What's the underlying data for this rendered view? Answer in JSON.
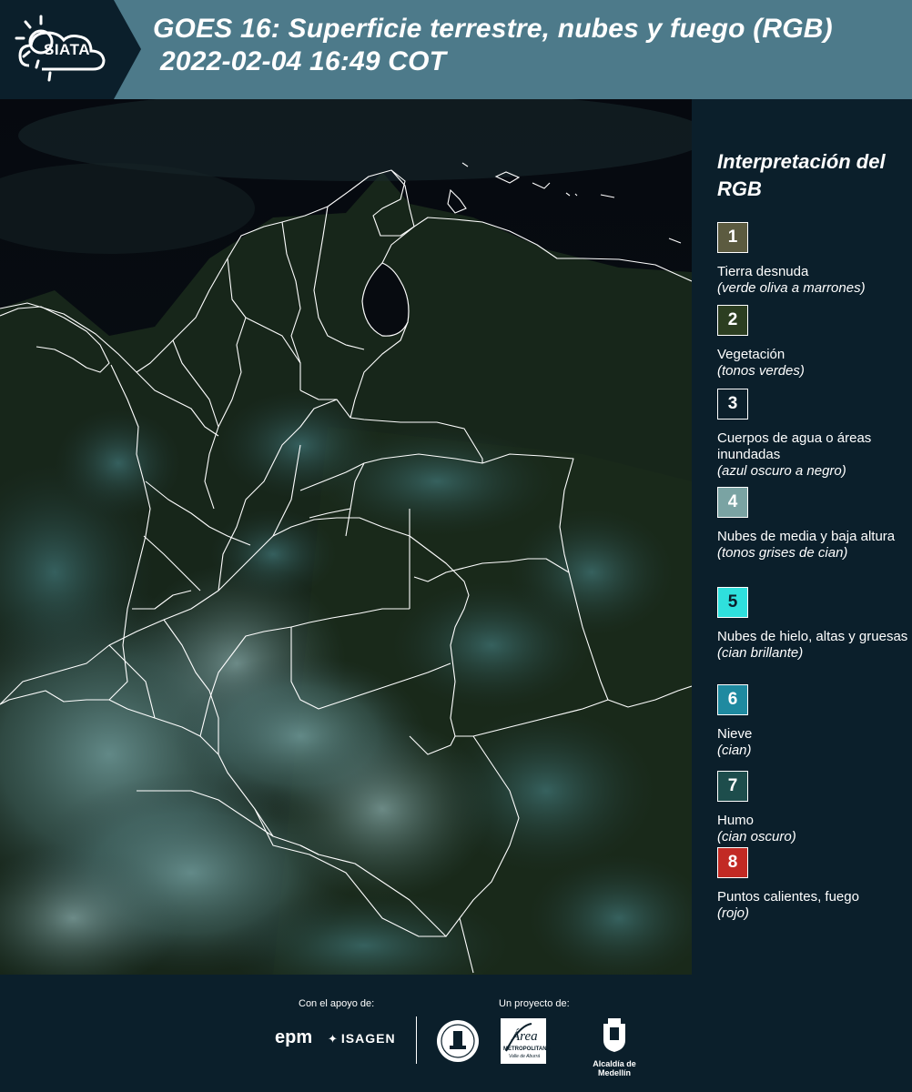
{
  "header": {
    "logo_text": "SIATA",
    "title_line1": "GOES 16: Superficie terrestre, nubes y fuego (RGB)",
    "title_line2": "2022-02-04 16:49 COT"
  },
  "legend": {
    "title": "Interpretación del RGB",
    "items": [
      {
        "number": "1",
        "label": "Tierra desnuda",
        "description": "(verde oliva a marrones)",
        "color": "#5c5b40",
        "text_color": "#ffffff"
      },
      {
        "number": "2",
        "label": "Vegetación",
        "description": "(tonos verdes)",
        "color": "#2c3e21",
        "text_color": "#ffffff"
      },
      {
        "number": "3",
        "label": "Cuerpos de agua o áreas inundadas",
        "description": "(azul oscuro a negro)",
        "color": "#0b1f2b",
        "text_color": "#ffffff"
      },
      {
        "number": "4",
        "label": "Nubes de media y baja altura",
        "description": "(tonos grises de cian)",
        "color": "#7aa3a3",
        "text_color": "#ffffff"
      },
      {
        "number": "5",
        "label": "Nubes de hielo, altas y gruesas",
        "description": "(cian brillante)",
        "color": "#2fe0dd",
        "text_color": "#0b1f2b"
      },
      {
        "number": "6",
        "label": "Nieve",
        "description": "(cian)",
        "color": "#1f8aa0",
        "text_color": "#ffffff"
      },
      {
        "number": "7",
        "label": "Humo",
        "description": "(cian oscuro)",
        "color": "#1d4d4c",
        "text_color": "#ffffff"
      },
      {
        "number": "8",
        "label": "Puntos calientes, fuego",
        "description": "(rojo)",
        "color": "#c22a24",
        "text_color": "#ffffff"
      }
    ]
  },
  "footer": {
    "support_label": "Con el apoyo de:",
    "project_label": "Un proyecto de:",
    "sponsors": [
      "epm",
      "ISAGEN"
    ],
    "partners": [
      "Área Metropolitana Valle de Aburrá",
      "Alcaldía de Medellín"
    ],
    "area_logo_text": "Área",
    "area_logo_subtext": "METROPOLITANA",
    "area_logo_tagline": "Valle de Aburrá",
    "alcaldia_label": "Alcaldía de Medellín"
  }
}
